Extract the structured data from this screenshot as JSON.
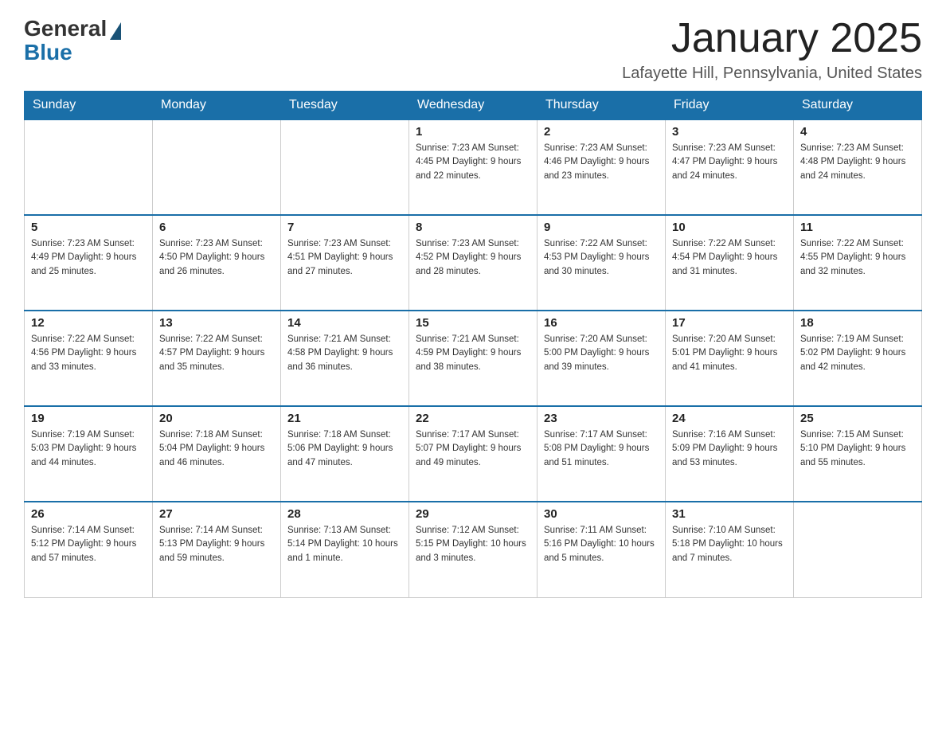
{
  "logo": {
    "general": "General",
    "blue": "Blue"
  },
  "title": "January 2025",
  "location": "Lafayette Hill, Pennsylvania, United States",
  "days_of_week": [
    "Sunday",
    "Monday",
    "Tuesday",
    "Wednesday",
    "Thursday",
    "Friday",
    "Saturday"
  ],
  "weeks": [
    [
      {
        "day": "",
        "info": ""
      },
      {
        "day": "",
        "info": ""
      },
      {
        "day": "",
        "info": ""
      },
      {
        "day": "1",
        "info": "Sunrise: 7:23 AM\nSunset: 4:45 PM\nDaylight: 9 hours\nand 22 minutes."
      },
      {
        "day": "2",
        "info": "Sunrise: 7:23 AM\nSunset: 4:46 PM\nDaylight: 9 hours\nand 23 minutes."
      },
      {
        "day": "3",
        "info": "Sunrise: 7:23 AM\nSunset: 4:47 PM\nDaylight: 9 hours\nand 24 minutes."
      },
      {
        "day": "4",
        "info": "Sunrise: 7:23 AM\nSunset: 4:48 PM\nDaylight: 9 hours\nand 24 minutes."
      }
    ],
    [
      {
        "day": "5",
        "info": "Sunrise: 7:23 AM\nSunset: 4:49 PM\nDaylight: 9 hours\nand 25 minutes."
      },
      {
        "day": "6",
        "info": "Sunrise: 7:23 AM\nSunset: 4:50 PM\nDaylight: 9 hours\nand 26 minutes."
      },
      {
        "day": "7",
        "info": "Sunrise: 7:23 AM\nSunset: 4:51 PM\nDaylight: 9 hours\nand 27 minutes."
      },
      {
        "day": "8",
        "info": "Sunrise: 7:23 AM\nSunset: 4:52 PM\nDaylight: 9 hours\nand 28 minutes."
      },
      {
        "day": "9",
        "info": "Sunrise: 7:22 AM\nSunset: 4:53 PM\nDaylight: 9 hours\nand 30 minutes."
      },
      {
        "day": "10",
        "info": "Sunrise: 7:22 AM\nSunset: 4:54 PM\nDaylight: 9 hours\nand 31 minutes."
      },
      {
        "day": "11",
        "info": "Sunrise: 7:22 AM\nSunset: 4:55 PM\nDaylight: 9 hours\nand 32 minutes."
      }
    ],
    [
      {
        "day": "12",
        "info": "Sunrise: 7:22 AM\nSunset: 4:56 PM\nDaylight: 9 hours\nand 33 minutes."
      },
      {
        "day": "13",
        "info": "Sunrise: 7:22 AM\nSunset: 4:57 PM\nDaylight: 9 hours\nand 35 minutes."
      },
      {
        "day": "14",
        "info": "Sunrise: 7:21 AM\nSunset: 4:58 PM\nDaylight: 9 hours\nand 36 minutes."
      },
      {
        "day": "15",
        "info": "Sunrise: 7:21 AM\nSunset: 4:59 PM\nDaylight: 9 hours\nand 38 minutes."
      },
      {
        "day": "16",
        "info": "Sunrise: 7:20 AM\nSunset: 5:00 PM\nDaylight: 9 hours\nand 39 minutes."
      },
      {
        "day": "17",
        "info": "Sunrise: 7:20 AM\nSunset: 5:01 PM\nDaylight: 9 hours\nand 41 minutes."
      },
      {
        "day": "18",
        "info": "Sunrise: 7:19 AM\nSunset: 5:02 PM\nDaylight: 9 hours\nand 42 minutes."
      }
    ],
    [
      {
        "day": "19",
        "info": "Sunrise: 7:19 AM\nSunset: 5:03 PM\nDaylight: 9 hours\nand 44 minutes."
      },
      {
        "day": "20",
        "info": "Sunrise: 7:18 AM\nSunset: 5:04 PM\nDaylight: 9 hours\nand 46 minutes."
      },
      {
        "day": "21",
        "info": "Sunrise: 7:18 AM\nSunset: 5:06 PM\nDaylight: 9 hours\nand 47 minutes."
      },
      {
        "day": "22",
        "info": "Sunrise: 7:17 AM\nSunset: 5:07 PM\nDaylight: 9 hours\nand 49 minutes."
      },
      {
        "day": "23",
        "info": "Sunrise: 7:17 AM\nSunset: 5:08 PM\nDaylight: 9 hours\nand 51 minutes."
      },
      {
        "day": "24",
        "info": "Sunrise: 7:16 AM\nSunset: 5:09 PM\nDaylight: 9 hours\nand 53 minutes."
      },
      {
        "day": "25",
        "info": "Sunrise: 7:15 AM\nSunset: 5:10 PM\nDaylight: 9 hours\nand 55 minutes."
      }
    ],
    [
      {
        "day": "26",
        "info": "Sunrise: 7:14 AM\nSunset: 5:12 PM\nDaylight: 9 hours\nand 57 minutes."
      },
      {
        "day": "27",
        "info": "Sunrise: 7:14 AM\nSunset: 5:13 PM\nDaylight: 9 hours\nand 59 minutes."
      },
      {
        "day": "28",
        "info": "Sunrise: 7:13 AM\nSunset: 5:14 PM\nDaylight: 10 hours\nand 1 minute."
      },
      {
        "day": "29",
        "info": "Sunrise: 7:12 AM\nSunset: 5:15 PM\nDaylight: 10 hours\nand 3 minutes."
      },
      {
        "day": "30",
        "info": "Sunrise: 7:11 AM\nSunset: 5:16 PM\nDaylight: 10 hours\nand 5 minutes."
      },
      {
        "day": "31",
        "info": "Sunrise: 7:10 AM\nSunset: 5:18 PM\nDaylight: 10 hours\nand 7 minutes."
      },
      {
        "day": "",
        "info": ""
      }
    ]
  ]
}
